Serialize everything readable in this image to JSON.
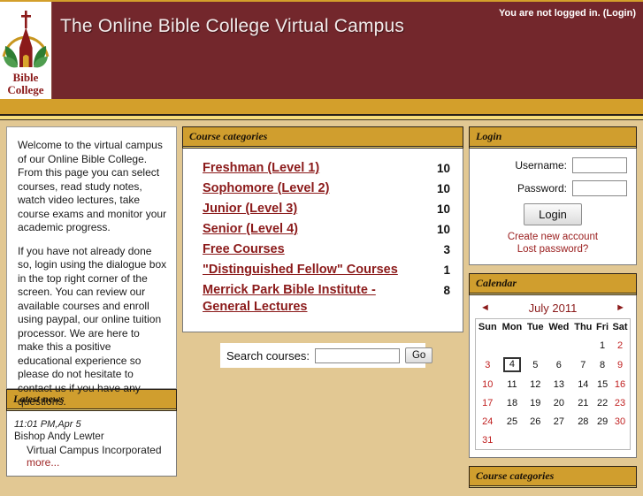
{
  "header": {
    "site_title": "The Online Bible College Virtual Campus",
    "login_status": "You are not logged in.",
    "login_link": "(Login)",
    "logo_line1": "Bible",
    "logo_line2": "College"
  },
  "welcome": {
    "paragraph1": "Welcome to the virtual campus of our Online Bible College. From this page you can select courses, read study notes, watch video lectures, take course exams and monitor your academic progress.",
    "paragraph2": "If you have not already done so, login using the dialogue box in the top right corner of the screen.  You can review our available courses and enroll using paypal, our online tuition processor.  We are here to make this a positive educational experience so please do not hesitate to contact us if you have any questions."
  },
  "latest_news": {
    "title": "Latest news",
    "items": [
      {
        "time": "11:01 PM,Apr 5",
        "author": "Bishop Andy Lewter",
        "subject": "Virtual Campus Incorporated",
        "more": "more..."
      }
    ]
  },
  "course_categories": {
    "title": "Course categories",
    "items": [
      {
        "name": "Freshman (Level 1)",
        "count": "10"
      },
      {
        "name": "Sophomore (Level 2)",
        "count": "10"
      },
      {
        "name": "Junior (Level 3)",
        "count": "10"
      },
      {
        "name": "Senior (Level 4)",
        "count": "10"
      },
      {
        "name": "Free Courses",
        "count": "3"
      },
      {
        "name": "\"Distinguished Fellow\" Courses",
        "count": "1"
      },
      {
        "name": "Merrick Park Bible Institute - General Lectures",
        "count": "8"
      }
    ]
  },
  "search": {
    "label": "Search courses:",
    "value": "",
    "placeholder": "",
    "button": "Go"
  },
  "login_block": {
    "title": "Login",
    "username_label": "Username:",
    "username_value": "",
    "password_label": "Password:",
    "password_value": "",
    "button": "Login",
    "create_account": "Create new account",
    "lost_password": "Lost password?"
  },
  "calendar": {
    "title": "Calendar",
    "prev_arrow": "◄",
    "next_arrow": "►",
    "month_label": "July 2011",
    "weekday_headers": [
      "Sun",
      "Mon",
      "Tue",
      "Wed",
      "Thu",
      "Fri",
      "Sat"
    ],
    "today": "4",
    "weeks": [
      [
        "",
        "",
        "",
        "",
        "",
        "1",
        "2"
      ],
      [
        "3",
        "4",
        "5",
        "6",
        "7",
        "8",
        "9"
      ],
      [
        "10",
        "11",
        "12",
        "13",
        "14",
        "15",
        "16"
      ],
      [
        "17",
        "18",
        "19",
        "20",
        "21",
        "22",
        "23"
      ],
      [
        "24",
        "25",
        "26",
        "27",
        "28",
        "29",
        "30"
      ],
      [
        "31",
        "",
        "",
        "",
        "",
        "",
        ""
      ]
    ]
  },
  "bottom_block": {
    "title": "Course categories"
  },
  "colors": {
    "header_maroon": "#73272c",
    "gold": "#d09e2e",
    "page_tan": "#e2c893",
    "link_red": "#8b1a1a",
    "weekend_red": "#c02020"
  }
}
